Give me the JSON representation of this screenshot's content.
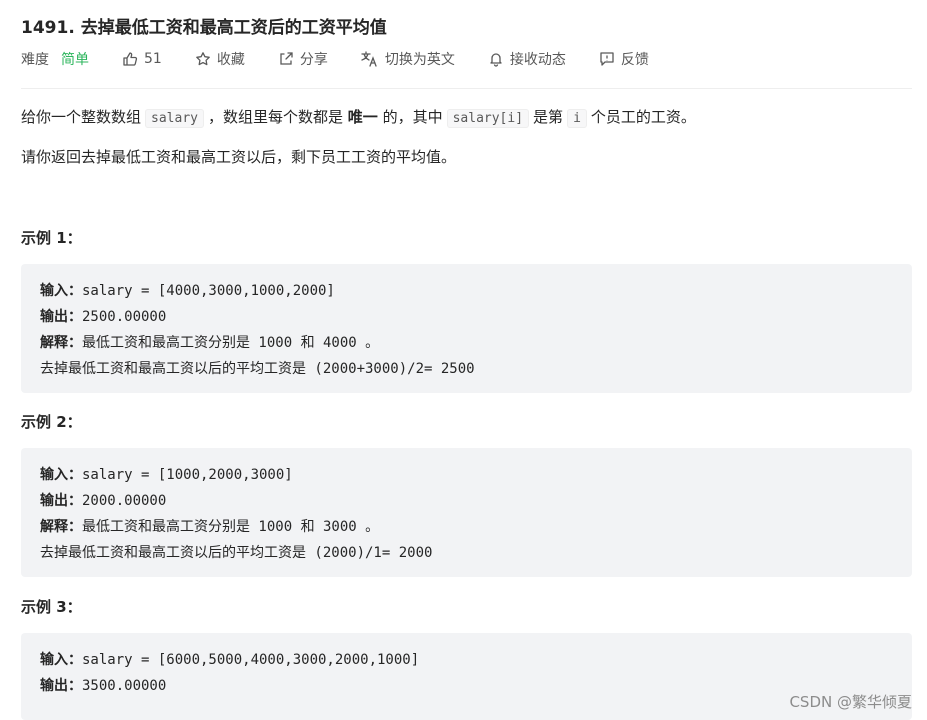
{
  "problem": {
    "title": "1491. 去掉最低工资和最高工资后的工资平均值",
    "difficulty_label": "难度",
    "difficulty_value": "简单"
  },
  "toolbar": {
    "like_count": "51",
    "favorite_label": "收藏",
    "share_label": "分享",
    "switch_lang_label": "切换为英文",
    "subscribe_label": "接收动态",
    "feedback_label": "反馈"
  },
  "description": {
    "p1_a": "给你一个整数数组",
    "p1_code1": "salary",
    "p1_b": "，数组里每个数都是",
    "p1_bold": "唯一",
    "p1_c": "的，其中",
    "p1_code2": "salary[i]",
    "p1_d": "是第",
    "p1_code3": "i",
    "p1_e": "个员工的工资。",
    "p2": "请你返回去掉最低工资和最高工资以后，剩下员工工资的平均值。"
  },
  "examples": [
    {
      "title": "示例 1：",
      "input_label": "输入：",
      "input": "salary = [4000,3000,1000,2000]",
      "output_label": "输出：",
      "output": "2500.00000",
      "explain_label": "解释：",
      "explain": "最低工资和最高工资分别是 1000 和 4000 。",
      "explain2": "去掉最低工资和最高工资以后的平均工资是 (2000+3000)/2= 2500"
    },
    {
      "title": "示例 2：",
      "input_label": "输入：",
      "input": "salary = [1000,2000,3000]",
      "output_label": "输出：",
      "output": "2000.00000",
      "explain_label": "解释：",
      "explain": "最低工资和最高工资分别是 1000 和 3000 。",
      "explain2": "去掉最低工资和最高工资以后的平均工资是 (2000)/1= 2000"
    },
    {
      "title": "示例 3：",
      "input_label": "输入：",
      "input": "salary = [6000,5000,4000,3000,2000,1000]",
      "output_label": "输出：",
      "output": "3500.00000"
    }
  ],
  "watermark": "CSDN @繁华倾夏",
  "colors": {
    "difficulty_easy": "#2db55d",
    "example_bg": "#f2f3f5"
  }
}
